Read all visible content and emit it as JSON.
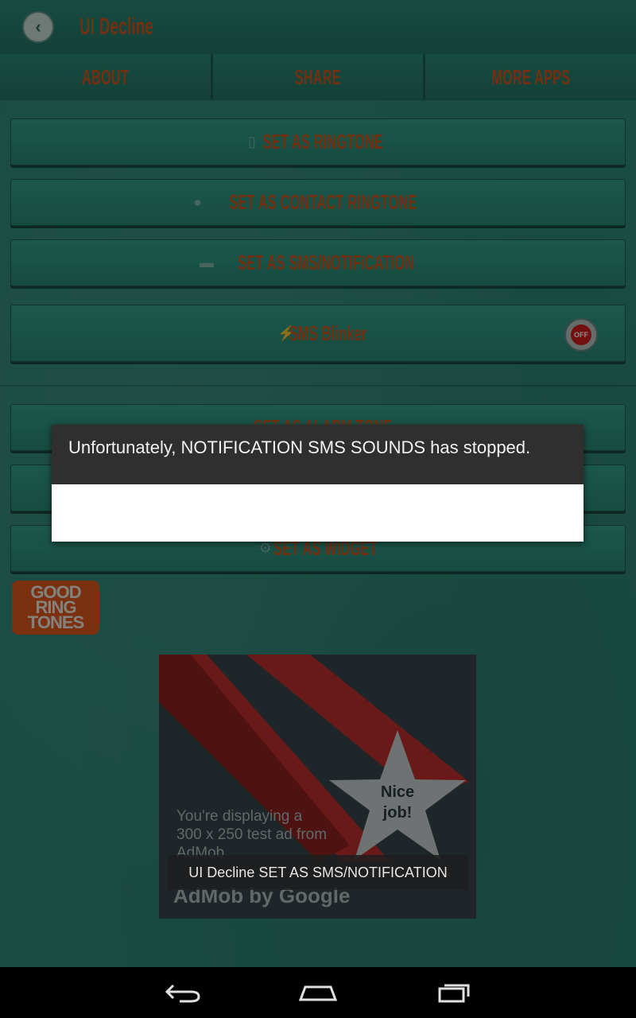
{
  "app": {
    "title": "UI Decline"
  },
  "tabs": [
    {
      "label": "ABOUT"
    },
    {
      "label": "SHARE"
    },
    {
      "label": "MORE APPS"
    }
  ],
  "buttons": {
    "ringtone": {
      "label": "SET AS RINGTONE",
      "icon": "phone-icon"
    },
    "contact": {
      "label": "SET AS CONTACT RINGTONE",
      "icon": "person-icon"
    },
    "sms": {
      "label": "SET AS SMS/NOTIFICATION",
      "icon": "chat-bubble-icon"
    },
    "blinker": {
      "label": "SMS Blinker",
      "icon": "lightning-icon",
      "toggle": "OFF"
    },
    "alarm": {
      "label": "SET AS ALARM TONE",
      "icon": "alarm-icon"
    },
    "widget": {
      "label": "SET AS WIDGET",
      "icon": "gear-icon"
    }
  },
  "logo": {
    "line1": "GOOD",
    "line2": "RING",
    "line3": "TONES"
  },
  "ad": {
    "text": "You're displaying a 300 x 250 test ad from AdMob",
    "star_text_1": "Nice",
    "star_text_2": "job!",
    "brand": "AdMob by Google",
    "colors": {
      "stripe": "#c0302c",
      "star": "#c9cfd1",
      "background": "#37464c"
    }
  },
  "dialog": {
    "message": "Unfortunately, NOTIFICATION SMS SOUNDS has stopped."
  },
  "toast": {
    "text": "UI Decline SET AS SMS/NOTIFICATION"
  },
  "colors": {
    "accent": "#d2571e",
    "background": "#2f8a7a"
  }
}
